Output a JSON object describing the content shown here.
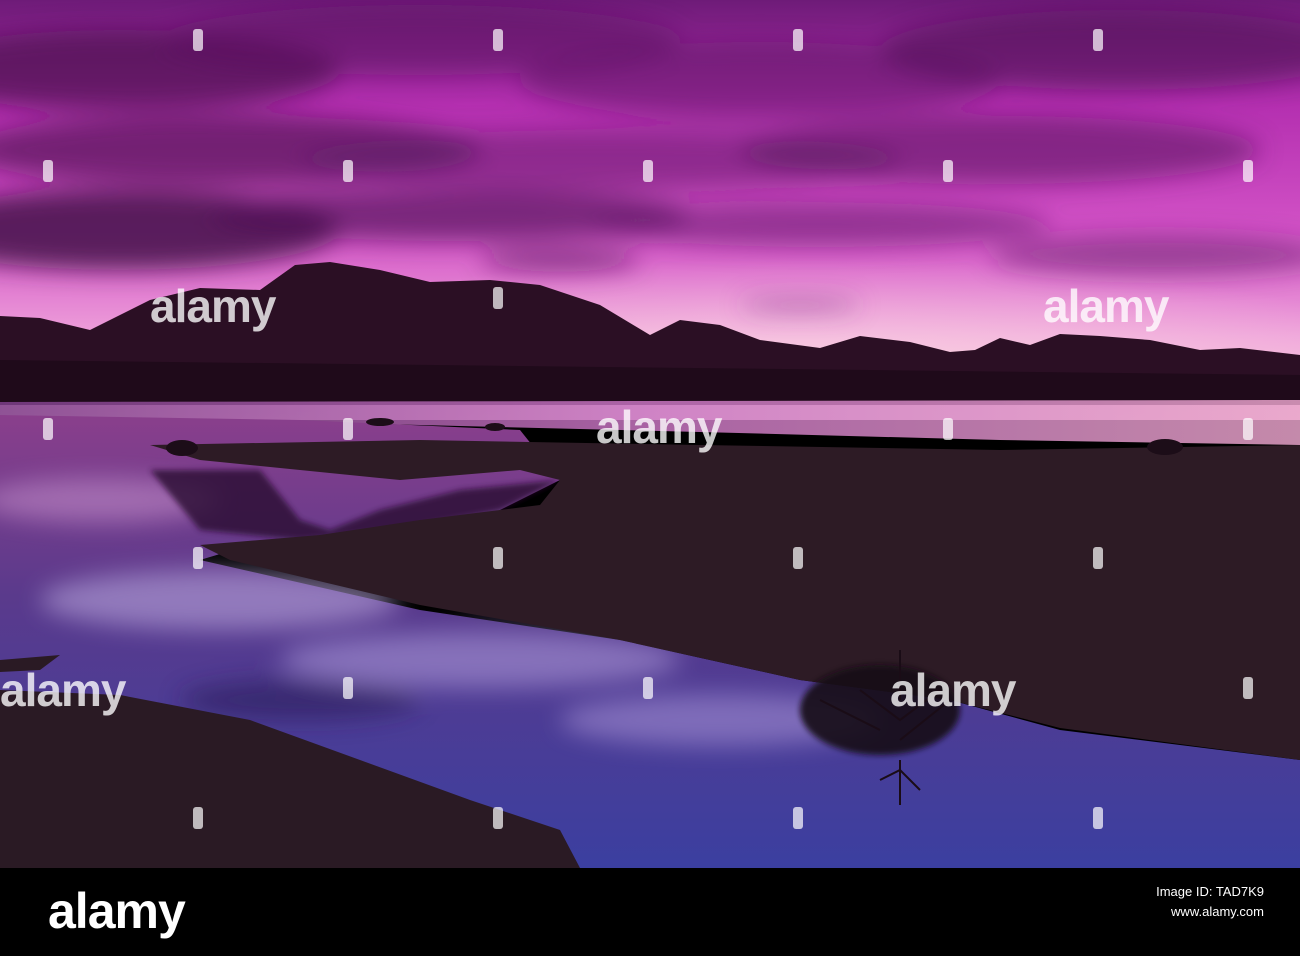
{
  "watermark": {
    "text": "alamy"
  },
  "footer": {
    "logo": "alamy",
    "image_id_label": "Image ID: TAD7K9",
    "image_id_value": "TAD7K9",
    "url": "www.alamy.com"
  },
  "colors": {
    "sky_top": "#7a1f7e",
    "sky_mid": "#c93fc0",
    "horizon_glow": "#f7b6d9",
    "mountain": "#2a0f22",
    "water": "#3a2a6e",
    "shore": "#2e1c26",
    "footer_bg": "#000000"
  }
}
